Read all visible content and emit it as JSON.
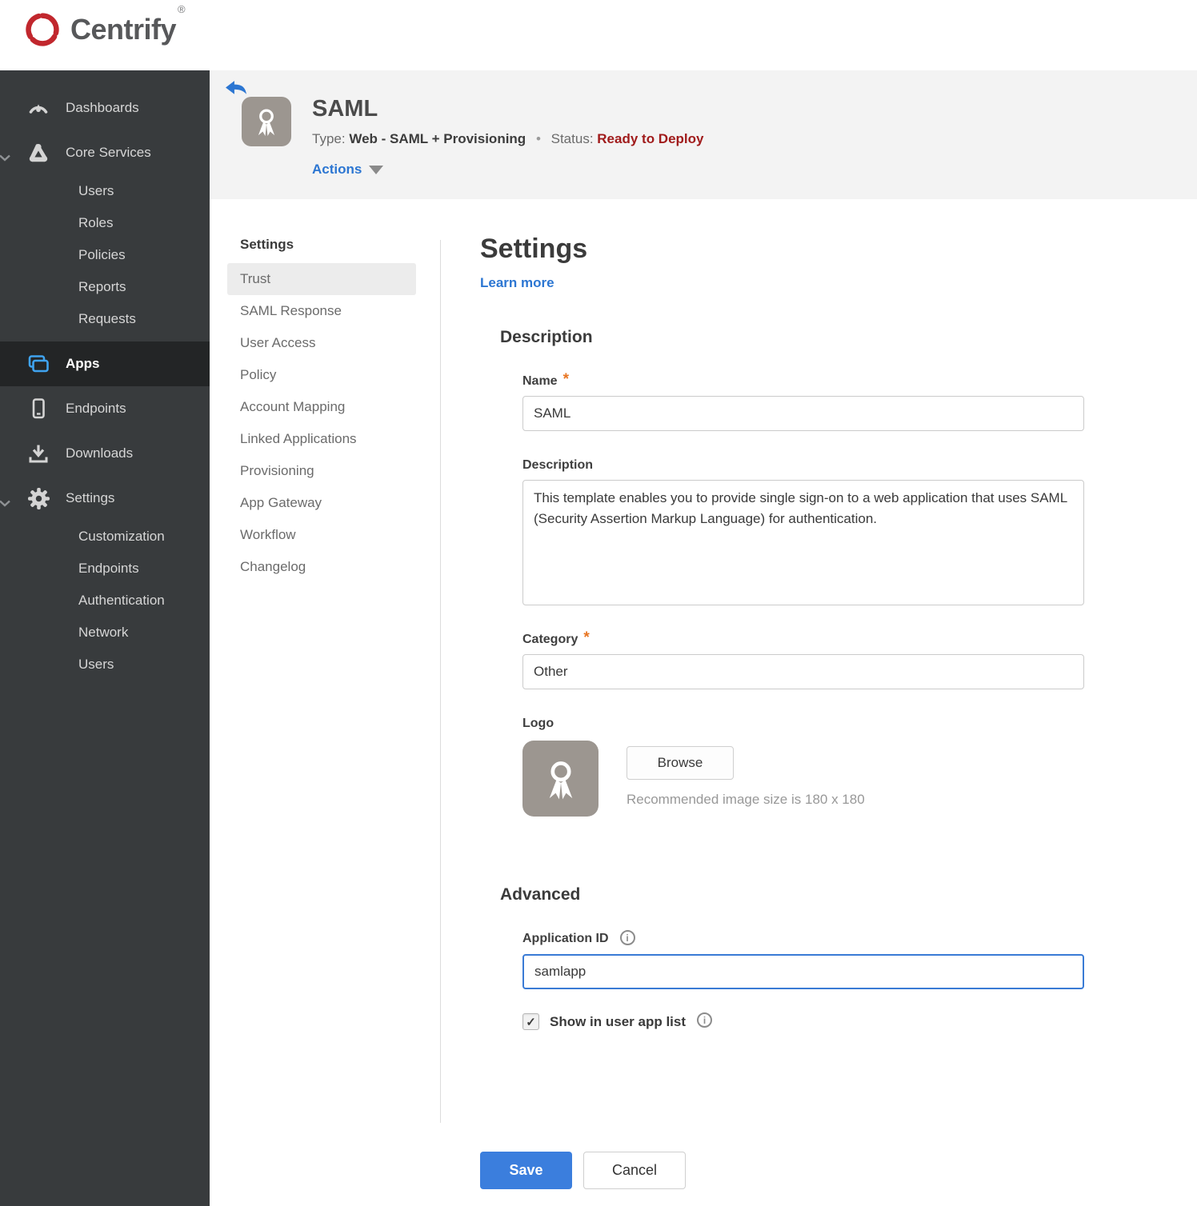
{
  "brand": {
    "name": "Centrify",
    "reg": "®"
  },
  "colors": {
    "accent_blue": "#2c76d2",
    "save_blue": "#3b7edd",
    "status_red": "#a01b1b",
    "required_orange": "#e87522",
    "sidebar_bg": "#383b3d",
    "sidebar_selected_bg": "#232526",
    "apps_icon_blue": "#3fa3ef",
    "header_bg": "#f3f3f3"
  },
  "icons": {
    "info_glyph": "i",
    "check_glyph": "✓"
  },
  "sidebar": {
    "items": [
      {
        "label": "Dashboards"
      },
      {
        "label": "Core Services",
        "children": [
          {
            "label": "Users"
          },
          {
            "label": "Roles"
          },
          {
            "label": "Policies"
          },
          {
            "label": "Reports"
          },
          {
            "label": "Requests"
          }
        ]
      },
      {
        "label": "Apps",
        "selected": true
      },
      {
        "label": "Endpoints"
      },
      {
        "label": "Downloads"
      },
      {
        "label": "Settings",
        "children": [
          {
            "label": "Customization"
          },
          {
            "label": "Endpoints"
          },
          {
            "label": "Authentication"
          },
          {
            "label": "Network"
          },
          {
            "label": "Users"
          }
        ]
      }
    ]
  },
  "header": {
    "app_title": "SAML",
    "type_label": "Type:",
    "type_value": "Web - SAML + Provisioning",
    "separator": "•",
    "status_label": "Status:",
    "status_value": "Ready to Deploy",
    "actions_label": "Actions"
  },
  "subnav": {
    "title": "Settings",
    "items": [
      {
        "label": "Trust",
        "selected": true
      },
      {
        "label": "SAML Response"
      },
      {
        "label": "User Access"
      },
      {
        "label": "Policy"
      },
      {
        "label": "Account Mapping"
      },
      {
        "label": "Linked Applications"
      },
      {
        "label": "Provisioning"
      },
      {
        "label": "App Gateway"
      },
      {
        "label": "Workflow"
      },
      {
        "label": "Changelog"
      }
    ]
  },
  "main": {
    "page_title": "Settings",
    "learn_more": "Learn more",
    "required_mark": "*",
    "description_section": {
      "title": "Description",
      "name": {
        "label": "Name",
        "value": "SAML",
        "required": true
      },
      "description": {
        "label": "Description",
        "value": "This template enables you to provide single sign-on to a web application that uses SAML (Security Assertion Markup Language) for authentication."
      },
      "category": {
        "label": "Category",
        "value": "Other",
        "required": true
      },
      "logo": {
        "label": "Logo",
        "browse_label": "Browse",
        "hint": "Recommended image size is 180 x 180"
      }
    },
    "advanced_section": {
      "title": "Advanced",
      "application_id": {
        "label": "Application ID",
        "value": "samlapp"
      },
      "show_in_app_list": {
        "label": "Show in user app list",
        "checked": true
      }
    }
  },
  "footer": {
    "save": "Save",
    "cancel": "Cancel"
  }
}
